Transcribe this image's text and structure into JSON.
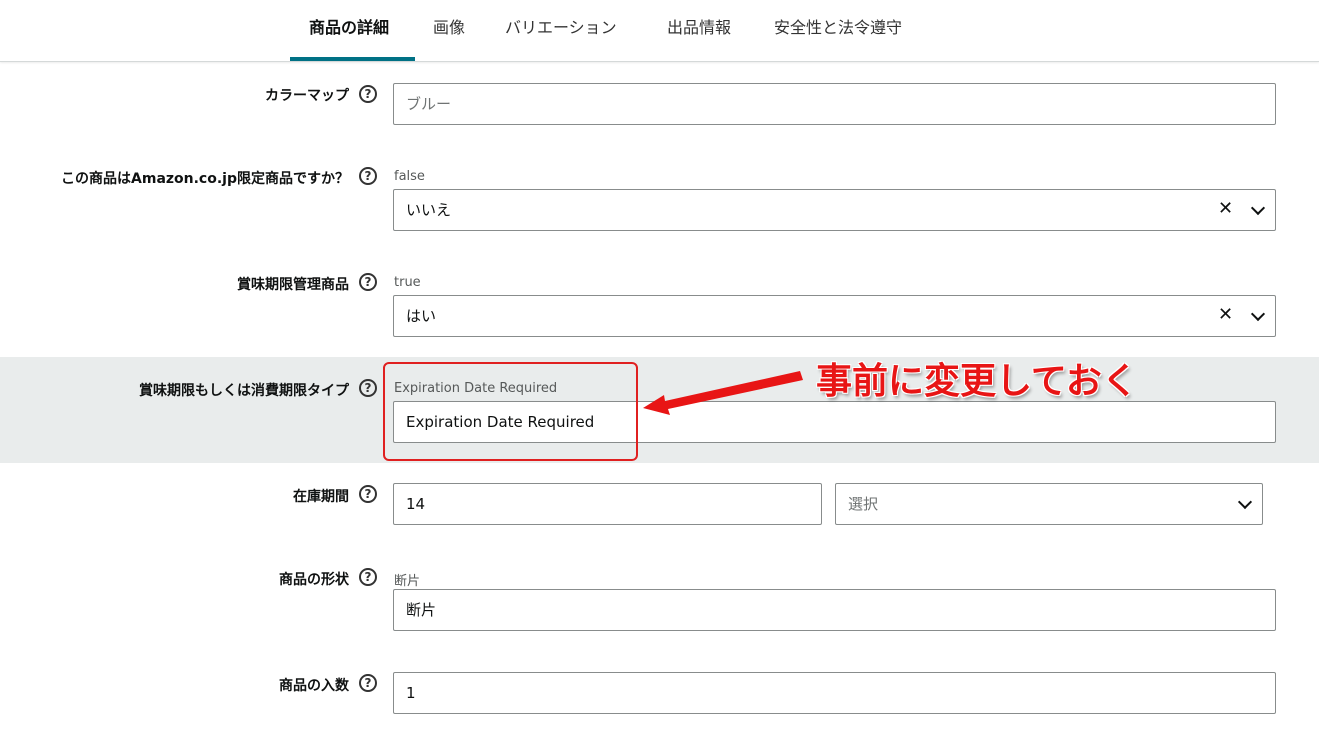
{
  "tabs": [
    {
      "label": "商品の詳細",
      "active": true
    },
    {
      "label": "画像"
    },
    {
      "label": "バリエーション"
    },
    {
      "label": "出品情報"
    },
    {
      "label": "安全性と法令遵守"
    }
  ],
  "help_glyph": "?",
  "fields": {
    "color_map": {
      "label": "カラーマップ",
      "placeholder": "ブルー"
    },
    "amazon_exclusive": {
      "label": "この商品はAmazon.co.jp限定商品ですか？",
      "hint": "false",
      "value": "いいえ"
    },
    "expiry_managed": {
      "label": "賞味期限管理商品",
      "hint": "true",
      "value": "はい"
    },
    "expiry_type": {
      "label": "賞味期限もしくは消費期限タイプ",
      "hint": "Expiration Date Required",
      "value": "Expiration Date Required"
    },
    "stock_period": {
      "label": "在庫期間",
      "value": "14",
      "unit_placeholder": "選択"
    },
    "product_form": {
      "label": "商品の形状",
      "hint": "断片",
      "value": "断片"
    },
    "item_count": {
      "label": "商品の入数",
      "value": "1"
    }
  },
  "annotation": {
    "text": "事前に変更しておく",
    "color": "#e81515"
  },
  "colors": {
    "accent": "#007185",
    "highlight_bg": "#e9ecec"
  },
  "icons": {
    "clear": "close-icon",
    "dropdown": "chevron-down-icon",
    "help": "help-circle-icon"
  }
}
